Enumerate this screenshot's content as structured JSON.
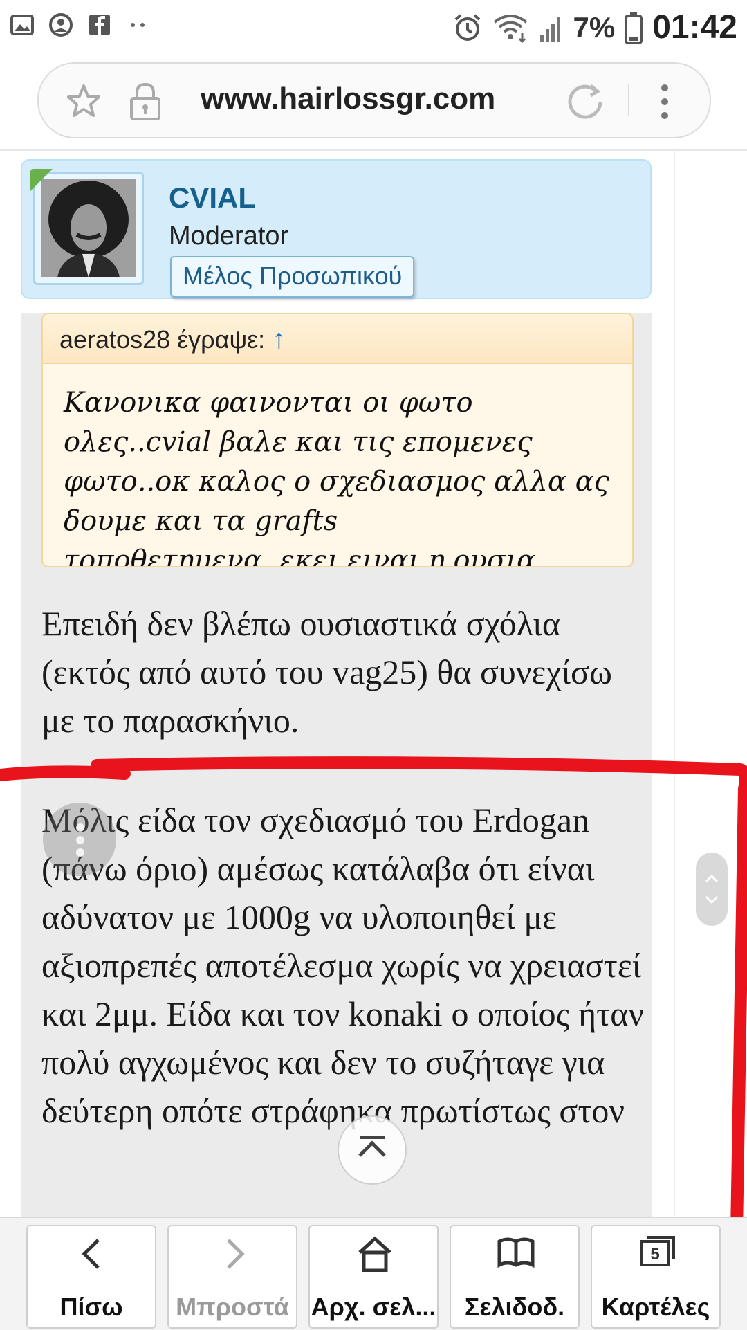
{
  "status_bar": {
    "battery_percent": "7%",
    "time": "01:42",
    "left_icons": [
      "image-icon",
      "account-circle-icon",
      "facebook-icon",
      "more-notifications-icon"
    ],
    "right_icons": [
      "alarm-icon",
      "wifi-icon",
      "signal-icon",
      "battery-icon"
    ]
  },
  "address_bar": {
    "url": "www.hairlossgr.com"
  },
  "post": {
    "author": {
      "username": "CVIAL",
      "title": "Moderator",
      "badge": "Μέλος Προσωπικού",
      "online": true
    },
    "quote": {
      "author_label": "aeratos28 έγραψε:",
      "arrow": "↑",
      "text": "Κανονικα φαινονται οι φωτο ολες..cvial βαλε και τις επομενες φωτο..οκ καλος ο σχεδιασμος αλλα ας δουμε και τα grafts τοποθετημενα..εκει ειναι η ουσια"
    },
    "paragraphs": [
      "Επειδή δεν βλέπω ουσιαστικά σχόλια (εκτός από αυτό του vag25) θα συνεχίσω με το παρασκήνιο.",
      "Μόλις είδα τον σχεδιασμό του Erdogan (πάνω όριο) αμέσως κατάλαβα ότι είναι αδύνατον με 1000g να υλοποιηθεί με αξιοπρεπές αποτέλεσμα χωρίς να χρειαστεί και 2μμ. Είδα και τον konaki ο οποίος ήταν πολύ αγχωμένος και δεν το συζήταγε για δεύτερη οπότε στράφηκα πρωτίστως στον"
    ]
  },
  "annotation": {
    "color": "#e8131b"
  },
  "bottom_nav": {
    "back": "Πίσω",
    "forward": "Μπροστά",
    "home": "Αρχ. σελ...",
    "bookmarks": "Σελιδοδ.",
    "tabs": "Καρτέλες",
    "tabs_count": "5"
  }
}
